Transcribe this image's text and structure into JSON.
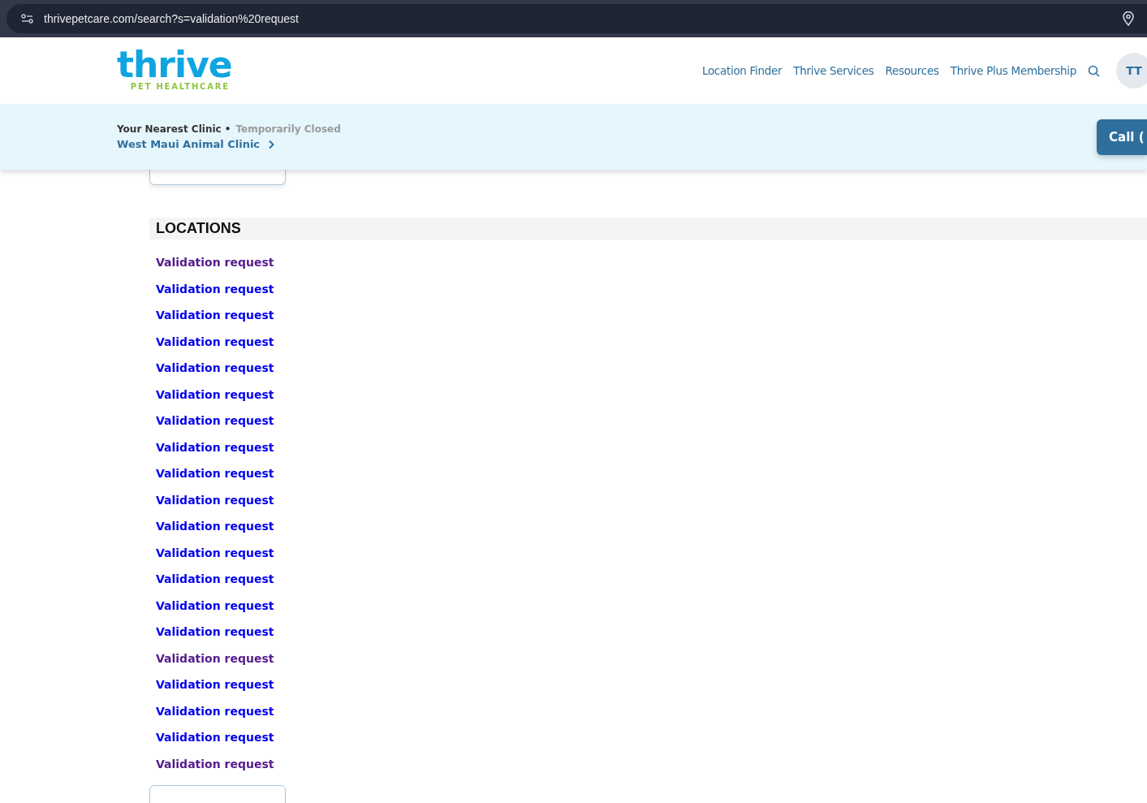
{
  "browser": {
    "url": "thrivepetcare.com/search?s=validation%20request"
  },
  "header": {
    "logo": {
      "word": "thrive",
      "tagline": "PET HEALTHCARE"
    },
    "nav": [
      "Location Finder",
      "Thrive Services",
      "Resources",
      "Thrive Plus Membership"
    ],
    "avatar": "TT"
  },
  "clinic_bar": {
    "label": "Your Nearest Clinic •",
    "status": "Temporarily Closed",
    "clinic": "West Maui Animal Clinic",
    "call_button": "Call ("
  },
  "locations": {
    "heading": "LOCATIONS",
    "results": [
      {
        "label": "Validation request",
        "visited": true
      },
      {
        "label": "Validation request",
        "visited": false
      },
      {
        "label": "Validation request",
        "visited": false
      },
      {
        "label": "Validation request",
        "visited": false
      },
      {
        "label": "Validation request",
        "visited": false
      },
      {
        "label": "Validation request",
        "visited": false
      },
      {
        "label": "Validation request",
        "visited": false
      },
      {
        "label": "Validation request",
        "visited": false
      },
      {
        "label": "Validation request",
        "visited": false
      },
      {
        "label": "Validation request",
        "visited": false
      },
      {
        "label": "Validation request",
        "visited": false
      },
      {
        "label": "Validation request",
        "visited": false
      },
      {
        "label": "Validation request",
        "visited": false
      },
      {
        "label": "Validation request",
        "visited": false
      },
      {
        "label": "Validation request",
        "visited": false
      },
      {
        "label": "Validation request",
        "visited": true
      },
      {
        "label": "Validation request",
        "visited": false
      },
      {
        "label": "Validation request",
        "visited": false
      },
      {
        "label": "Validation request",
        "visited": false
      },
      {
        "label": "Validation request",
        "visited": true
      }
    ]
  }
}
